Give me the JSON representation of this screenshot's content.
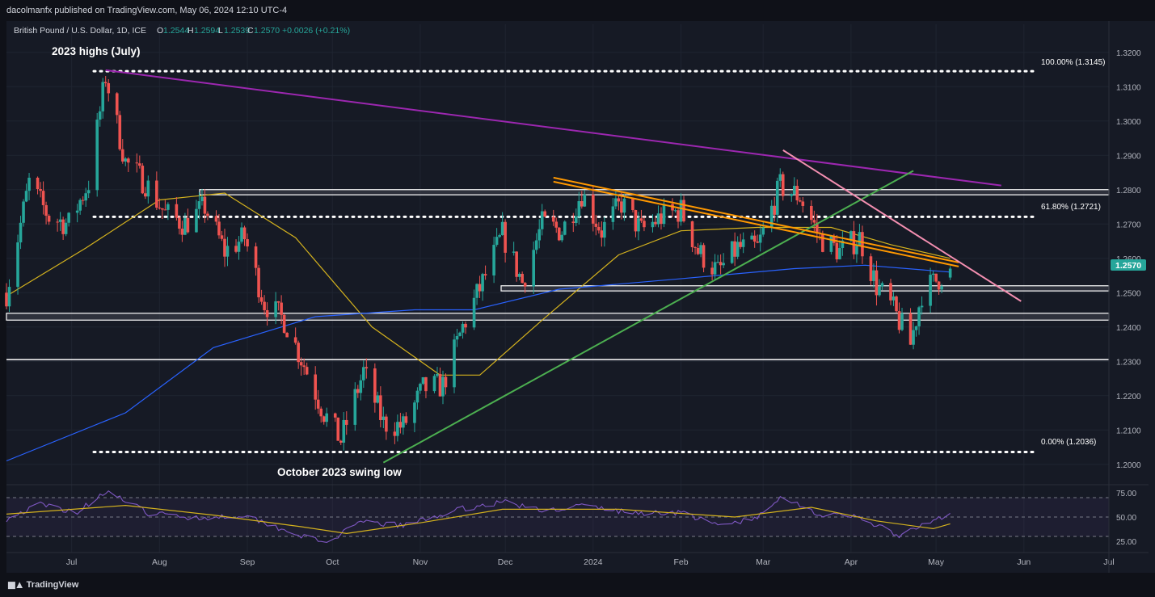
{
  "header": {
    "published": "dacolmanfx published on TradingView.com, May 06, 2024 12:10 UTC-4"
  },
  "legend": {
    "symbol": "British Pound / U.S. Dollar, 1D, ICE",
    "open_label": "O",
    "open": "1.2544",
    "high_label": "H",
    "high": "1.2594",
    "low_label": "L",
    "low": "1.2539",
    "close_label": "C",
    "close": "1.2570",
    "change": "+0.0026 (+0.21%)"
  },
  "colors": {
    "background": "#161a25",
    "up": "#26a69a",
    "down": "#ef5350",
    "ma_short": "#d4b21e",
    "ma_long": "#2962ff",
    "long_trendline": "#9c27b0",
    "support_trendline": "#4caf50",
    "resistance_trendline": "#ff9800",
    "pink_trendline": "#f48fb1",
    "rsi": "#7e57c2",
    "rsi_ma": "#d4b21e",
    "price_tag": "#26a69a"
  },
  "price_axis": {
    "ticks": [
      "1.3200",
      "1.3100",
      "1.3000",
      "1.2900",
      "1.2800",
      "1.2700",
      "1.2600",
      "1.2500",
      "1.2400",
      "1.2300",
      "1.2200",
      "1.2100",
      "1.2000"
    ],
    "last_price": "1.2570"
  },
  "rsi_axis": {
    "ticks": [
      "75.00",
      "50.00",
      "25.00"
    ]
  },
  "time_axis": {
    "labels": [
      "Jul",
      "Aug",
      "Sep",
      "Oct",
      "Nov",
      "Dec",
      "2024",
      "Feb",
      "Mar",
      "Apr",
      "May",
      "Jun",
      "Jul"
    ]
  },
  "annotations": {
    "highs": "2023 highs (July)",
    "lows": "October 2023 swing low",
    "fib_100": "100.00% (1.3145)",
    "fib_618": "61.80% (1.2721)",
    "fib_0": "0.00% (1.2036)"
  },
  "footer": {
    "brand": "TradingView"
  },
  "chart_data": {
    "type": "candlestick",
    "title": "British Pound / U.S. Dollar, 1D, ICE",
    "x_range": [
      "2023-06-08",
      "2024-07-01"
    ],
    "y_range": [
      1.195,
      1.323
    ],
    "last_close": 1.257,
    "ohlc_last": {
      "open": 1.2544,
      "high": 1.2594,
      "low": 1.2539,
      "close": 1.257
    },
    "close_path": [
      {
        "date": "2023-06-08",
        "close": 1.25
      },
      {
        "date": "2023-06-16",
        "close": 1.282
      },
      {
        "date": "2023-06-23",
        "close": 1.272
      },
      {
        "date": "2023-06-30",
        "close": 1.27
      },
      {
        "date": "2023-07-07",
        "close": 1.282
      },
      {
        "date": "2023-07-13",
        "close": 1.313
      },
      {
        "date": "2023-07-20",
        "close": 1.288
      },
      {
        "date": "2023-07-27",
        "close": 1.282
      },
      {
        "date": "2023-08-03",
        "close": 1.273
      },
      {
        "date": "2023-08-10",
        "close": 1.27
      },
      {
        "date": "2023-08-17",
        "close": 1.275
      },
      {
        "date": "2023-08-24",
        "close": 1.262
      },
      {
        "date": "2023-08-31",
        "close": 1.266
      },
      {
        "date": "2023-09-07",
        "close": 1.247
      },
      {
        "date": "2023-09-14",
        "close": 1.242
      },
      {
        "date": "2023-09-21",
        "close": 1.229
      },
      {
        "date": "2023-09-28",
        "close": 1.215
      },
      {
        "date": "2023-10-04",
        "close": 1.207
      },
      {
        "date": "2023-10-12",
        "close": 1.227
      },
      {
        "date": "2023-10-19",
        "close": 1.212
      },
      {
        "date": "2023-10-26",
        "close": 1.211
      },
      {
        "date": "2023-11-02",
        "close": 1.222
      },
      {
        "date": "2023-11-09",
        "close": 1.223
      },
      {
        "date": "2023-11-16",
        "close": 1.24
      },
      {
        "date": "2023-11-23",
        "close": 1.253
      },
      {
        "date": "2023-11-30",
        "close": 1.267
      },
      {
        "date": "2023-12-07",
        "close": 1.253
      },
      {
        "date": "2023-12-14",
        "close": 1.27
      },
      {
        "date": "2023-12-21",
        "close": 1.268
      },
      {
        "date": "2023-12-28",
        "close": 1.279
      },
      {
        "date": "2024-01-04",
        "close": 1.268
      },
      {
        "date": "2024-01-11",
        "close": 1.276
      },
      {
        "date": "2024-01-18",
        "close": 1.268
      },
      {
        "date": "2024-01-25",
        "close": 1.272
      },
      {
        "date": "2024-02-01",
        "close": 1.274
      },
      {
        "date": "2024-02-07",
        "close": 1.262
      },
      {
        "date": "2024-02-14",
        "close": 1.256
      },
      {
        "date": "2024-02-21",
        "close": 1.263
      },
      {
        "date": "2024-02-28",
        "close": 1.263
      },
      {
        "date": "2024-03-07",
        "close": 1.281
      },
      {
        "date": "2024-03-14",
        "close": 1.278
      },
      {
        "date": "2024-03-21",
        "close": 1.266
      },
      {
        "date": "2024-03-28",
        "close": 1.262
      },
      {
        "date": "2024-04-04",
        "close": 1.266
      },
      {
        "date": "2024-04-10",
        "close": 1.252
      },
      {
        "date": "2024-04-16",
        "close": 1.245
      },
      {
        "date": "2024-04-22",
        "close": 1.235
      },
      {
        "date": "2024-04-26",
        "close": 1.25
      },
      {
        "date": "2024-05-06",
        "close": 1.257
      }
    ],
    "horizontal_levels": [
      {
        "type": "fib_100",
        "price": 1.3145,
        "style": "dotted"
      },
      {
        "type": "zone",
        "price_low": 1.2785,
        "price_high": 1.28,
        "style": "band"
      },
      {
        "type": "fib_618",
        "price": 1.2721,
        "style": "dotted"
      },
      {
        "type": "zone",
        "price_low": 1.2505,
        "price_high": 1.252,
        "style": "band"
      },
      {
        "type": "zone",
        "price_low": 1.242,
        "price_high": 1.244,
        "style": "band"
      },
      {
        "type": "line",
        "price": 1.2305,
        "style": "solid"
      },
      {
        "type": "fib_0",
        "price": 1.2036,
        "style": "dotted"
      }
    ],
    "trendlines": [
      {
        "name": "long-term resistance",
        "color": "#9c27b0",
        "from": {
          "date": "2023-07-13",
          "price": 1.3148
        },
        "to": {
          "date": "2024-05-24",
          "price": 1.2812
        }
      },
      {
        "name": "support from October low",
        "color": "#4caf50",
        "from": {
          "date": "2023-10-19",
          "price": 1.2005
        },
        "to": {
          "date": "2024-04-23",
          "price": 1.2855
        }
      },
      {
        "name": "descending resistance",
        "color": "#ff9800",
        "from": {
          "date": "2023-12-18",
          "price": 1.2835
        },
        "to": {
          "date": "2024-05-09",
          "price": 1.2588
        }
      },
      {
        "name": "March high descending",
        "color": "#f48fb1",
        "from": {
          "date": "2024-03-08",
          "price": 1.2915
        },
        "to": {
          "date": "2024-05-31",
          "price": 1.2475
        }
      }
    ],
    "moving_averages": [
      {
        "name": "short-term MA",
        "color": "#d4b21e",
        "points": [
          {
            "date": "2023-06-08",
            "value": 1.249
          },
          {
            "date": "2023-07-06",
            "value": 1.263
          },
          {
            "date": "2023-08-01",
            "value": 1.277
          },
          {
            "date": "2023-08-24",
            "value": 1.279
          },
          {
            "date": "2023-09-18",
            "value": 1.266
          },
          {
            "date": "2023-10-15",
            "value": 1.24
          },
          {
            "date": "2023-11-08",
            "value": 1.226
          },
          {
            "date": "2023-11-22",
            "value": 1.226
          },
          {
            "date": "2023-12-14",
            "value": 1.242
          },
          {
            "date": "2024-01-10",
            "value": 1.261
          },
          {
            "date": "2024-02-01",
            "value": 1.268
          },
          {
            "date": "2024-02-28",
            "value": 1.269
          },
          {
            "date": "2024-03-25",
            "value": 1.269
          },
          {
            "date": "2024-04-15",
            "value": 1.264
          },
          {
            "date": "2024-05-06",
            "value": 1.26
          }
        ]
      },
      {
        "name": "long-term MA",
        "color": "#2962ff",
        "points": [
          {
            "date": "2023-06-08",
            "value": 1.201
          },
          {
            "date": "2023-07-20",
            "value": 1.215
          },
          {
            "date": "2023-08-20",
            "value": 1.234
          },
          {
            "date": "2023-09-25",
            "value": 1.243
          },
          {
            "date": "2023-10-30",
            "value": 1.245
          },
          {
            "date": "2023-11-20",
            "value": 1.245
          },
          {
            "date": "2023-12-20",
            "value": 1.251
          },
          {
            "date": "2024-01-31",
            "value": 1.254
          },
          {
            "date": "2024-03-12",
            "value": 1.257
          },
          {
            "date": "2024-04-06",
            "value": 1.258
          },
          {
            "date": "2024-05-06",
            "value": 1.256
          }
        ]
      }
    ],
    "rsi": {
      "ylim": [
        20,
        80
      ],
      "levels": [
        70,
        50,
        30
      ],
      "points": [
        {
          "date": "2023-06-08",
          "value": 48
        },
        {
          "date": "2023-06-20",
          "value": 63
        },
        {
          "date": "2023-07-03",
          "value": 55
        },
        {
          "date": "2023-07-13",
          "value": 77
        },
        {
          "date": "2023-07-28",
          "value": 54
        },
        {
          "date": "2023-08-15",
          "value": 49
        },
        {
          "date": "2023-08-31",
          "value": 52
        },
        {
          "date": "2023-09-14",
          "value": 37
        },
        {
          "date": "2023-09-28",
          "value": 23
        },
        {
          "date": "2023-10-12",
          "value": 45
        },
        {
          "date": "2023-10-26",
          "value": 41
        },
        {
          "date": "2023-11-15",
          "value": 58
        },
        {
          "date": "2023-12-01",
          "value": 66
        },
        {
          "date": "2023-12-14",
          "value": 56
        },
        {
          "date": "2023-12-28",
          "value": 62
        },
        {
          "date": "2024-01-15",
          "value": 54
        },
        {
          "date": "2024-02-01",
          "value": 55
        },
        {
          "date": "2024-02-14",
          "value": 41
        },
        {
          "date": "2024-02-28",
          "value": 49
        },
        {
          "date": "2024-03-08",
          "value": 72
        },
        {
          "date": "2024-03-21",
          "value": 52
        },
        {
          "date": "2024-04-04",
          "value": 50
        },
        {
          "date": "2024-04-18",
          "value": 30
        },
        {
          "date": "2024-04-24",
          "value": 38
        },
        {
          "date": "2024-05-06",
          "value": 54
        }
      ],
      "ma_points": [
        {
          "date": "2023-06-08",
          "value": 53
        },
        {
          "date": "2023-07-20",
          "value": 62
        },
        {
          "date": "2023-08-20",
          "value": 52
        },
        {
          "date": "2023-09-20",
          "value": 40
        },
        {
          "date": "2023-10-06",
          "value": 33
        },
        {
          "date": "2023-11-01",
          "value": 44
        },
        {
          "date": "2023-11-30",
          "value": 58
        },
        {
          "date": "2024-01-10",
          "value": 58
        },
        {
          "date": "2024-02-20",
          "value": 50
        },
        {
          "date": "2024-03-18",
          "value": 60
        },
        {
          "date": "2024-04-10",
          "value": 46
        },
        {
          "date": "2024-04-30",
          "value": 38
        },
        {
          "date": "2024-05-06",
          "value": 43
        }
      ]
    }
  }
}
